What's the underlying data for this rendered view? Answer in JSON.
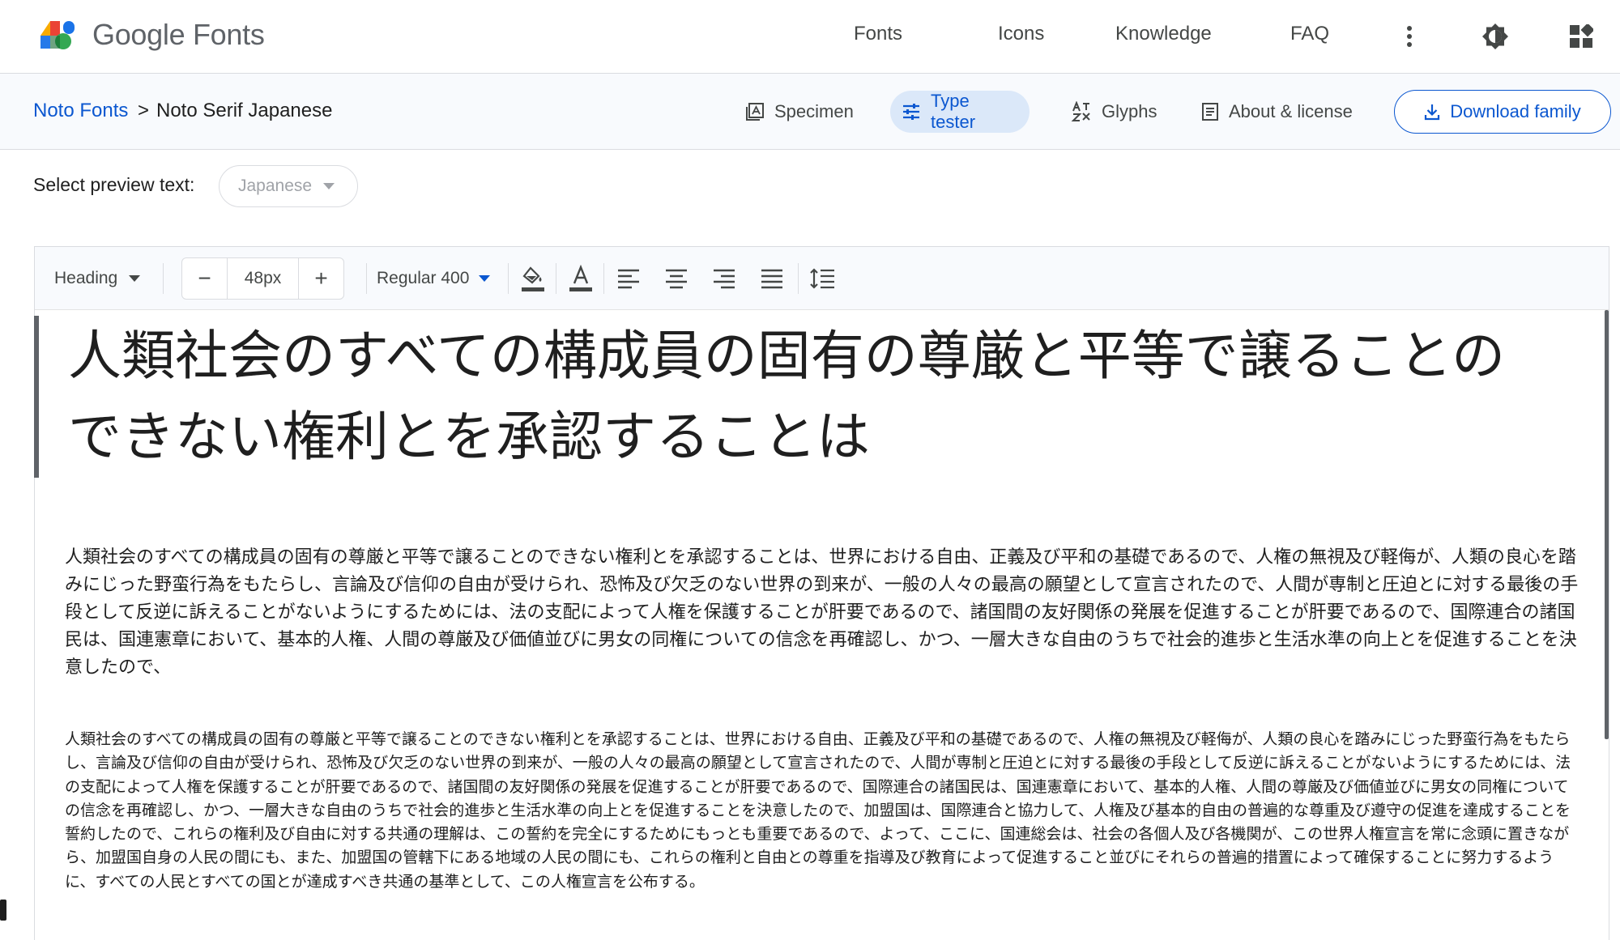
{
  "header": {
    "brand": "Google Fonts",
    "nav": [
      "Fonts",
      "Icons",
      "Knowledge",
      "FAQ"
    ],
    "icons": [
      "more-vert-icon",
      "theme-toggle-icon",
      "apps-icon"
    ]
  },
  "subheader": {
    "breadcrumb_link": "Noto Fonts",
    "breadcrumb_sep": ">",
    "breadcrumb_current": "Noto Serif Japanese",
    "tabs": [
      {
        "label": "Specimen",
        "icon": "specimen-icon"
      },
      {
        "label": "Type tester",
        "icon": "tune-icon",
        "active": true
      },
      {
        "label": "Glyphs",
        "icon": "glyphs-icon"
      },
      {
        "label": "About & license",
        "icon": "article-icon"
      }
    ],
    "download_label": "Download family"
  },
  "preview": {
    "label": "Select preview text:",
    "selected": "Japanese"
  },
  "toolbar": {
    "style_label": "Heading",
    "size_value": "48px",
    "minus": "−",
    "plus": "+",
    "weight_label": "Regular 400"
  },
  "samples": {
    "heading": "人類社会のすべての構成員の固有の尊厳と平等で譲ることのできない権利とを承認することは",
    "body": "人類社会のすべての構成員の固有の尊厳と平等で譲ることのできない権利とを承認することは、世界における自由、正義及び平和の基礎であるので、人権の無視及び軽侮が、人類の良心を踏みにじった野蛮行為をもたらし、言論及び信仰の自由が受けられ、恐怖及び欠乏のない世界の到来が、一般の人々の最高の願望として宣言されたので、人間が専制と圧迫とに対する最後の手段として反逆に訴えることがないようにするためには、法の支配によって人権を保護することが肝要であるので、諸国間の友好関係の発展を促進することが肝要であるので、国際連合の諸国民は、国連憲章において、基本的人権、人間の尊厳及び価値並びに男女の同権についての信念を再確認し、かつ、一層大きな自由のうちで社会的進歩と生活水準の向上とを促進することを決意したので、",
    "small": "人類社会のすべての構成員の固有の尊厳と平等で譲ることのできない権利とを承認することは、世界における自由、正義及び平和の基礎であるので、人権の無視及び軽侮が、人類の良心を踏みにじった野蛮行為をもたらし、言論及び信仰の自由が受けられ、恐怖及び欠乏のない世界の到来が、一般の人々の最高の願望として宣言されたので、人間が専制と圧迫とに対する最後の手段として反逆に訴えることがないようにするためには、法の支配によって人権を保護することが肝要であるので、諸国間の友好関係の発展を促進することが肝要であるので、国際連合の諸国民は、国連憲章において、基本的人権、人間の尊厳及び価値並びに男女の同権についての信念を再確認し、かつ、一層大きな自由のうちで社会的進歩と生活水準の向上とを促進することを決意したので、加盟国は、国際連合と協力して、人権及び基本的自由の普遍的な尊重及び遵守の促進を達成することを誓約したので、これらの権利及び自由に対する共通の理解は、この誓約を完全にするためにもっとも重要であるので、よって、ここに、国連総会は、社会の各個人及び各機関が、この世界人権宣言を常に念頭に置きながら、加盟国自身の人民の間にも、また、加盟国の管轄下にある地域の人民の間にも、これらの権利と自由との尊重を指導及び教育によって促進すること並びにそれらの普遍的措置によって確保することに努力するように、すべての人民とすべての国とが達成すべき共通の基準として、この人権宣言を公布する。"
  },
  "colors": {
    "accent": "#0b57d0",
    "active_tab_bg": "#dbe8f9",
    "text": "#1f1f1f",
    "muted": "#444746"
  }
}
